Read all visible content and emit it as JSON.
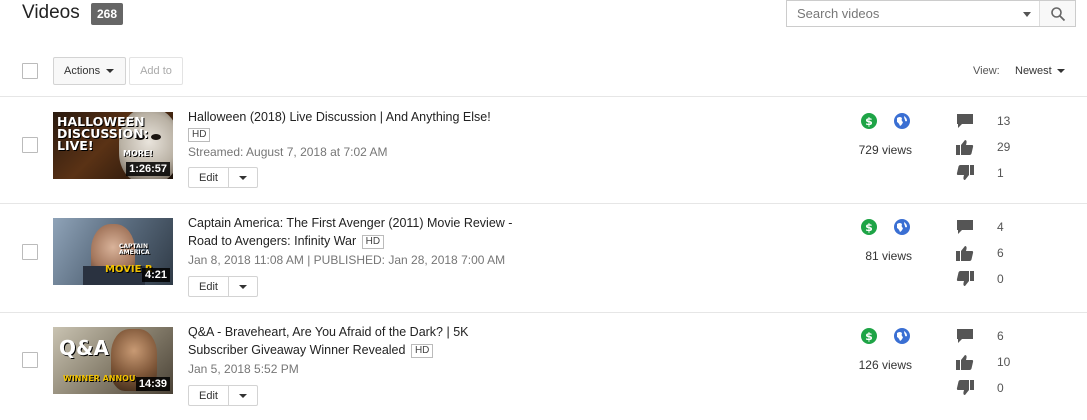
{
  "header": {
    "title": "Videos",
    "count": "268",
    "search_placeholder": "Search videos"
  },
  "toolbar": {
    "actions_label": "Actions",
    "add_to_label": "Add to",
    "view_label": "View:",
    "sort_value": "Newest"
  },
  "icons": {
    "monetization": "dollar-circle-icon",
    "visibility": "globe-icon",
    "comments": "comment-icon",
    "likes": "thumbs-up-icon",
    "dislikes": "thumbs-down-icon",
    "search": "search-icon"
  },
  "colors": {
    "monetization_green": "#1ea446",
    "public_blue": "#3a6fd3",
    "badge_gray": "#666666"
  },
  "videos": [
    {
      "title": "Halloween (2018) Live Discussion | And Anything Else!",
      "quality": "HD",
      "meta": "Streamed: August 7, 2018 at 7:02 AM",
      "duration": "1:26:57",
      "thumb_text": "HALLOWEEN DISCUSSION: LIVE!",
      "thumb_text_small": "MORE!",
      "edit_label": "Edit",
      "views": "729 views",
      "comments": "13",
      "likes": "29",
      "dislikes": "1"
    },
    {
      "title": "Captain America: The First Avenger (2011) Movie Review - Road to Avengers: Infinity War",
      "quality": "HD",
      "meta": "Jan 8, 2018 11:08 AM | PUBLISHED: Jan 28, 2018 7:00 AM",
      "duration": "4:21",
      "thumb_text": "MOVIE R",
      "thumb_text_small": "CAPTAIN AMERICA",
      "edit_label": "Edit",
      "views": "81 views",
      "comments": "4",
      "likes": "6",
      "dislikes": "0"
    },
    {
      "title": "Q&A - Braveheart, Are You Afraid of the Dark? | 5K Subscriber Giveaway Winner Revealed",
      "quality": "HD",
      "meta": "Jan 5, 2018 5:52 PM",
      "duration": "14:39",
      "thumb_text": "Q&A",
      "thumb_text_small": "WINNER ANNOU",
      "edit_label": "Edit",
      "views": "126 views",
      "comments": "6",
      "likes": "10",
      "dislikes": "0"
    }
  ]
}
